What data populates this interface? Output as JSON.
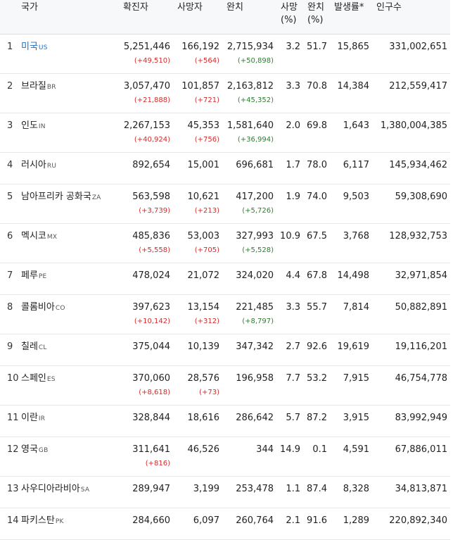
{
  "table": {
    "headers": {
      "country": "국가",
      "confirmed": "확진자",
      "deaths": "사망자",
      "recovered": "완치",
      "death_rate": [
        "사망",
        "(%)"
      ],
      "recovery_rate": [
        "완치",
        "(%)"
      ],
      "incidence": "발생률*",
      "population": "인구수"
    },
    "rows": [
      {
        "rank": "1",
        "name": "미국",
        "code": "US",
        "link": true,
        "confirmed": "5,251,446",
        "confirmed_delta": "(+49,510)",
        "deaths": "166,192",
        "deaths_delta": "(+564)",
        "recovered": "2,715,934",
        "recovered_delta": "(+50,898)",
        "death_rate": "3.2",
        "recovery_rate": "51.7",
        "incidence": "15,865",
        "population": "331,002,651"
      },
      {
        "rank": "2",
        "name": "브라질",
        "code": "BR",
        "confirmed": "3,057,470",
        "confirmed_delta": "(+21,888)",
        "deaths": "101,857",
        "deaths_delta": "(+721)",
        "recovered": "2,163,812",
        "recovered_delta": "(+45,352)",
        "death_rate": "3.3",
        "recovery_rate": "70.8",
        "incidence": "14,384",
        "population": "212,559,417"
      },
      {
        "rank": "3",
        "name": "인도",
        "code": "IN",
        "confirmed": "2,267,153",
        "confirmed_delta": "(+40,924)",
        "deaths": "45,353",
        "deaths_delta": "(+756)",
        "recovered": "1,581,640",
        "recovered_delta": "(+36,994)",
        "death_rate": "2.0",
        "recovery_rate": "69.8",
        "incidence": "1,643",
        "population": "1,380,004,385"
      },
      {
        "rank": "4",
        "name": "러시아",
        "code": "RU",
        "confirmed": "892,654",
        "deaths": "15,001",
        "recovered": "696,681",
        "death_rate": "1.7",
        "recovery_rate": "78.0",
        "incidence": "6,117",
        "population": "145,934,462"
      },
      {
        "rank": "5",
        "name": "남아프리카 공화국",
        "code": "ZA",
        "confirmed": "563,598",
        "confirmed_delta": "(+3,739)",
        "deaths": "10,621",
        "deaths_delta": "(+213)",
        "recovered": "417,200",
        "recovered_delta": "(+5,726)",
        "death_rate": "1.9",
        "recovery_rate": "74.0",
        "incidence": "9,503",
        "population": "59,308,690"
      },
      {
        "rank": "6",
        "name": "멕시코",
        "code": "MX",
        "confirmed": "485,836",
        "confirmed_delta": "(+5,558)",
        "deaths": "53,003",
        "deaths_delta": "(+705)",
        "recovered": "327,993",
        "recovered_delta": "(+5,528)",
        "death_rate": "10.9",
        "recovery_rate": "67.5",
        "incidence": "3,768",
        "population": "128,932,753"
      },
      {
        "rank": "7",
        "name": "페루",
        "code": "PE",
        "confirmed": "478,024",
        "deaths": "21,072",
        "recovered": "324,020",
        "death_rate": "4.4",
        "recovery_rate": "67.8",
        "incidence": "14,498",
        "population": "32,971,854"
      },
      {
        "rank": "8",
        "name": "콜롬비아",
        "code": "CO",
        "confirmed": "397,623",
        "confirmed_delta": "(+10,142)",
        "deaths": "13,154",
        "deaths_delta": "(+312)",
        "recovered": "221,485",
        "recovered_delta": "(+8,797)",
        "death_rate": "3.3",
        "recovery_rate": "55.7",
        "incidence": "7,814",
        "population": "50,882,891"
      },
      {
        "rank": "9",
        "name": "칠레",
        "code": "CL",
        "confirmed": "375,044",
        "deaths": "10,139",
        "recovered": "347,342",
        "death_rate": "2.7",
        "recovery_rate": "92.6",
        "incidence": "19,619",
        "population": "19,116,201"
      },
      {
        "rank": "10",
        "name": "스페인",
        "code": "ES",
        "confirmed": "370,060",
        "confirmed_delta": "(+8,618)",
        "deaths": "28,576",
        "deaths_delta": "(+73)",
        "recovered": "196,958",
        "death_rate": "7.7",
        "recovery_rate": "53.2",
        "incidence": "7,915",
        "population": "46,754,778"
      },
      {
        "rank": "11",
        "name": "이란",
        "code": "IR",
        "confirmed": "328,844",
        "deaths": "18,616",
        "recovered": "286,642",
        "death_rate": "5.7",
        "recovery_rate": "87.2",
        "incidence": "3,915",
        "population": "83,992,949"
      },
      {
        "rank": "12",
        "name": "영국",
        "code": "GB",
        "confirmed": "311,641",
        "confirmed_delta": "(+816)",
        "deaths": "46,526",
        "recovered": "344",
        "death_rate": "14.9",
        "recovery_rate": "0.1",
        "incidence": "4,591",
        "population": "67,886,011"
      },
      {
        "rank": "13",
        "name": "사우디아라비아",
        "code": "SA",
        "confirmed": "289,947",
        "deaths": "3,199",
        "recovered": "253,478",
        "death_rate": "1.1",
        "recovery_rate": "87.4",
        "incidence": "8,328",
        "population": "34,813,871"
      },
      {
        "rank": "14",
        "name": "파키스탄",
        "code": "PK",
        "confirmed": "284,660",
        "deaths": "6,097",
        "recovered": "260,764",
        "death_rate": "2.1",
        "recovery_rate": "91.6",
        "incidence": "1,289",
        "population": "220,892,340"
      }
    ]
  }
}
